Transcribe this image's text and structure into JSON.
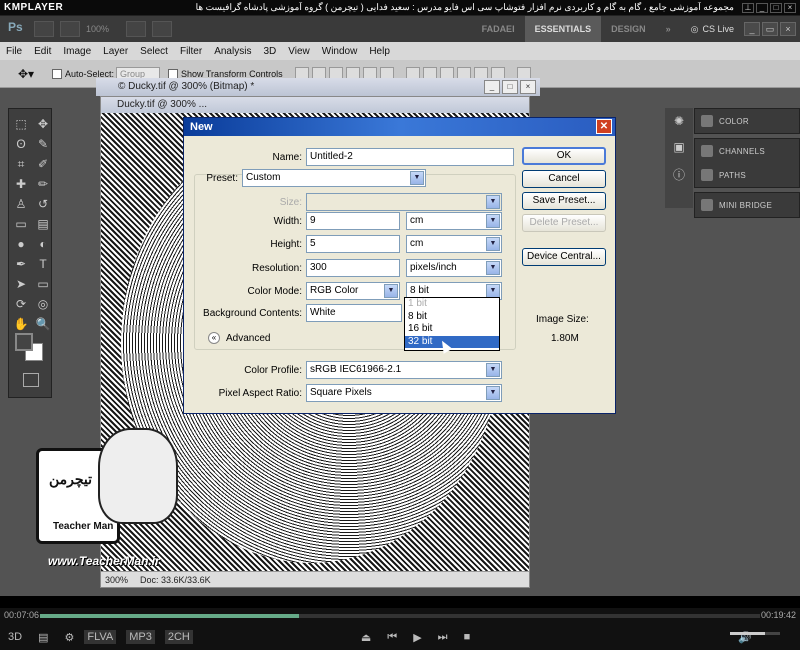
{
  "player": {
    "name": "KMPLAYER",
    "title": "مجموعه آموزشی جامع ، گام به گام و کاربردی نرم افزار فتوشاپ سی اس فایو  مدرس : سعید فدایی ( تیچرمن ) گروه آموزشی پادشاه گرافیست ها",
    "time_elapsed": "00:07:06",
    "time_total": "00:19:42",
    "progress": 0.36,
    "volume": 0.7,
    "badges": [
      "FLVA",
      "MP3",
      "2CH"
    ]
  },
  "photoshop": {
    "logo": "Ps",
    "zoom": "100%",
    "workspaces": [
      "FADAEI",
      "ESSENTIALS",
      "DESIGN"
    ],
    "active_workspace": "ESSENTIALS",
    "cs_live": "CS Live",
    "menu": [
      "File",
      "Edit",
      "Image",
      "Layer",
      "Select",
      "Filter",
      "Analysis",
      "3D",
      "View",
      "Window",
      "Help"
    ],
    "options": {
      "auto_select": "Auto-Select:",
      "group": "Group",
      "show_transform": "Show Transform Controls"
    },
    "panels": {
      "color": "COLOR",
      "channels": "CHANNELS",
      "paths": "PATHS",
      "mini_bridge": "MINI BRIDGE"
    },
    "doc_back_title": "© Ducky.tif @ 300% (Bitmap) *",
    "doc_front_title": "Ducky.tif @ 300% ...",
    "doc_zoom": "300%",
    "doc_status": "Doc: 33.6K/33.6K"
  },
  "dialog": {
    "title": "New",
    "name_label": "Name:",
    "name_value": "Untitled-2",
    "preset_label": "Preset:",
    "preset_value": "Custom",
    "size_label": "Size:",
    "width_label": "Width:",
    "width_value": "9",
    "width_unit": "cm",
    "height_label": "Height:",
    "height_value": "5",
    "height_unit": "cm",
    "resolution_label": "Resolution:",
    "resolution_value": "300",
    "resolution_unit": "pixels/inch",
    "color_mode_label": "Color Mode:",
    "color_mode_value": "RGB Color",
    "bit_depth_value": "8 bit",
    "bg_contents_label": "Background Contents:",
    "bg_contents_value": "White",
    "advanced_label": "Advanced",
    "color_profile_label": "Color Profile:",
    "color_profile_value": "sRGB IEC61966-2.1",
    "pixel_aspect_label": "Pixel Aspect Ratio:",
    "pixel_aspect_value": "Square Pixels",
    "ok": "OK",
    "cancel": "Cancel",
    "save_preset": "Save Preset...",
    "delete_preset": "Delete Preset...",
    "device_central": "Device Central...",
    "image_size_label": "Image Size:",
    "image_size_value": "1.80M",
    "bit_options": [
      "1 bit",
      "8 bit",
      "16 bit",
      "32 bit"
    ],
    "bit_selected": "32 bit"
  },
  "logo": {
    "brand": "تیچرمن",
    "name": "Teacher Man",
    "url": "www.TeacherMan.ir"
  }
}
